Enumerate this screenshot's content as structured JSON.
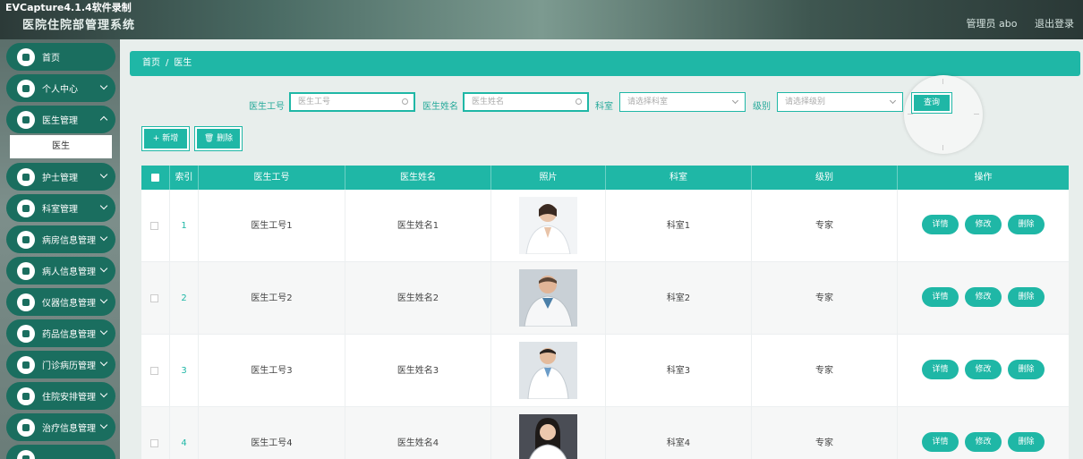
{
  "recorder": "EVCapture4.1.4软件录制",
  "header": {
    "title": "医院住院部管理系统",
    "user": "管理员 abo",
    "logout": "退出登录"
  },
  "sidebar": {
    "items": [
      {
        "label": "首页"
      },
      {
        "label": "个人中心"
      },
      {
        "label": "医生管理"
      },
      {
        "label": "护士管理"
      },
      {
        "label": "科室管理"
      },
      {
        "label": "病房信息管理"
      },
      {
        "label": "病人信息管理"
      },
      {
        "label": "仪器信息管理"
      },
      {
        "label": "药品信息管理"
      },
      {
        "label": "门诊病历管理"
      },
      {
        "label": "住院安排管理"
      },
      {
        "label": "治疗信息管理"
      }
    ],
    "sub_item": "医生"
  },
  "breadcrumb": {
    "home": "首页",
    "current": "医生"
  },
  "search": {
    "doctor_id_label": "医生工号",
    "doctor_id_placeholder": "医生工号",
    "doctor_name_label": "医生姓名",
    "doctor_name_placeholder": "医生姓名",
    "dept_label": "科室",
    "dept_placeholder": "请选择科室",
    "level_label": "级别",
    "level_placeholder": "请选择级别",
    "query": "查询"
  },
  "actions": {
    "add": "+ 新增",
    "delete": "删除"
  },
  "table": {
    "columns": [
      "索引",
      "医生工号",
      "医生姓名",
      "照片",
      "科室",
      "级别",
      "操作"
    ],
    "rows": [
      {
        "idx": "1",
        "id": "医生工号1",
        "name": "医生姓名1",
        "dept": "科室1",
        "level": "专家"
      },
      {
        "idx": "2",
        "id": "医生工号2",
        "name": "医生姓名2",
        "dept": "科室2",
        "level": "专家"
      },
      {
        "idx": "3",
        "id": "医生工号3",
        "name": "医生姓名3",
        "dept": "科室3",
        "level": "专家"
      },
      {
        "idx": "4",
        "id": "医生工号4",
        "name": "医生姓名4",
        "dept": "科室4",
        "level": "专家"
      }
    ],
    "ops": {
      "detail": "详情",
      "edit": "修改",
      "delete": "删除"
    }
  },
  "colors": {
    "accent": "#1fb7a6",
    "sidebar_item": "#1a6e5f"
  }
}
